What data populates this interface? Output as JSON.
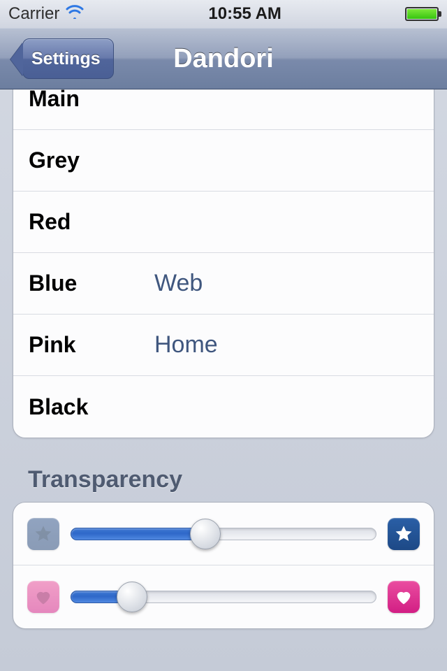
{
  "status": {
    "carrier": "Carrier",
    "time": "10:55 AM"
  },
  "nav": {
    "back_label": "Settings",
    "title": "Dandori"
  },
  "colors_section": {
    "items": [
      {
        "label": "Main",
        "value": ""
      },
      {
        "label": "Grey",
        "value": ""
      },
      {
        "label": "Red",
        "value": ""
      },
      {
        "label": "Blue",
        "value": "Web"
      },
      {
        "label": "Pink",
        "value": "Home"
      },
      {
        "label": "Black",
        "value": ""
      }
    ]
  },
  "transparency": {
    "header": "Transparency",
    "slider_star": {
      "percent": 44
    },
    "slider_heart": {
      "percent": 20
    }
  },
  "palette": {
    "blue_badge": "#1d4986",
    "pink_badge": "#d21e84",
    "link_text": "#3f567e"
  }
}
